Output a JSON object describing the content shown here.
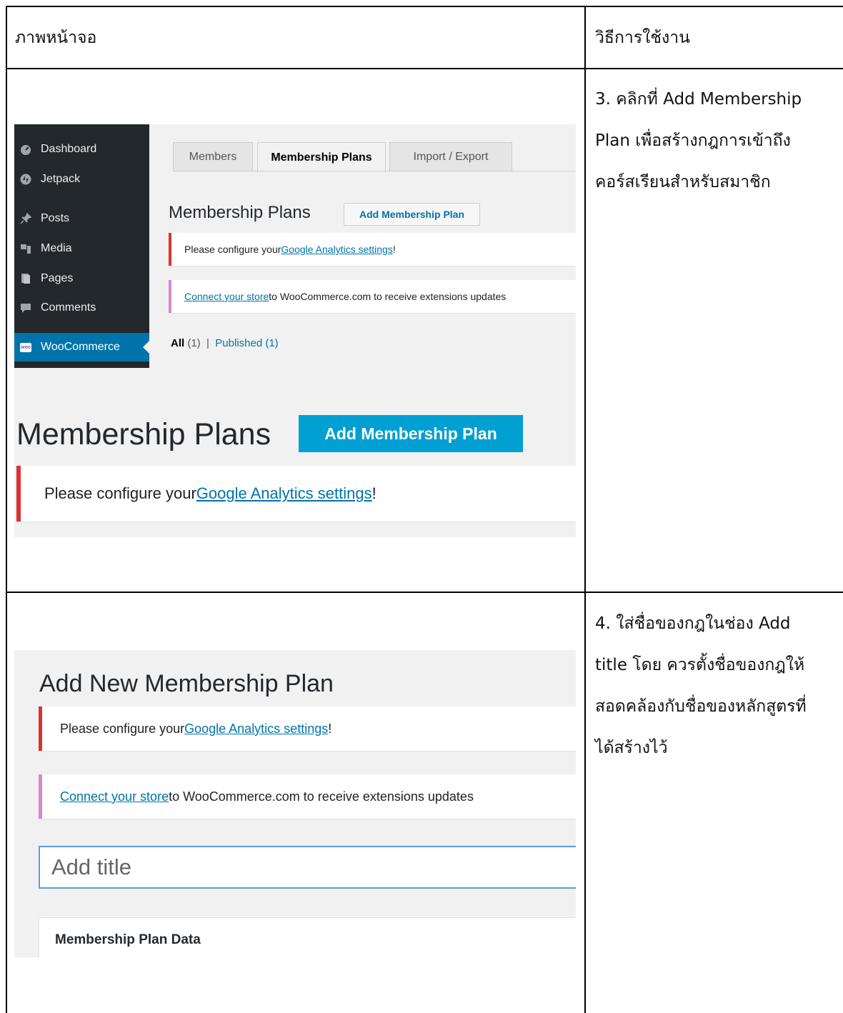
{
  "table": {
    "header_left": "ภาพหน้าจอ",
    "header_right": "วิธีการใช้งาน"
  },
  "step3": {
    "lines": [
      "3. คลิกที่ Add Membership",
      "Plan เพื่อสร้างกฎการเข้าถึง",
      "คอร์สเรียนสำหรับสมาชิก"
    ]
  },
  "step4": {
    "lines": [
      "4. ใส่ชื่อของกฎในช่อง Add",
      "title  โดย ควรตั้งชื่อของกฎให้",
      "สอดคล้องกับชื่อของหลักสูตรที่",
      "ได้สร้างไว้"
    ]
  },
  "shot1": {
    "sidebar": [
      {
        "label": "Dashboard",
        "icon": "dashboard-icon"
      },
      {
        "label": "Jetpack",
        "icon": "jetpack-icon"
      },
      {
        "label": "Posts",
        "icon": "pin-icon"
      },
      {
        "label": "Media",
        "icon": "media-icon"
      },
      {
        "label": "Pages",
        "icon": "pages-icon"
      },
      {
        "label": "Comments",
        "icon": "comment-icon"
      },
      {
        "label": "WooCommerce",
        "icon": "woo-icon",
        "badge": "woo"
      }
    ],
    "tabs": [
      "Members",
      "Membership Plans",
      "Import / Export"
    ],
    "heading": "Membership Plans",
    "add_button": "Add Membership Plan",
    "notice_ga": {
      "before": "Please configure your ",
      "link": "Google Analytics settings",
      "after": "!"
    },
    "notice_connect": {
      "link": "Connect your store",
      "after": " to WooCommerce.com to receive extensions updates"
    },
    "filter": {
      "all": "All",
      "all_count": "(1)",
      "sep": "|",
      "published": "Published",
      "published_count": "(1)"
    },
    "zoom_heading": "Membership Plans",
    "zoom_button": "Add Membership Plan",
    "zoom_notice": {
      "before": "Please configure your ",
      "link": "Google Analytics settings",
      "after": "!"
    }
  },
  "shot2": {
    "heading": "Add New Membership Plan",
    "notice_ga": {
      "before": "Please configure your ",
      "link": "Google Analytics settings",
      "after": "!"
    },
    "notice_connect": {
      "link": "Connect your store",
      "after": " to WooCommerce.com to receive extensions updates"
    },
    "title_placeholder": "Add title",
    "metabox_title": "Membership Plan Data"
  },
  "colors": {
    "wp_sidebar": "#23282d",
    "wp_active": "#0073aa",
    "button_primary": "#00a0d2",
    "notice_error": "#dc3232",
    "notice_info": "#d789c9",
    "link": "#0073aa"
  }
}
